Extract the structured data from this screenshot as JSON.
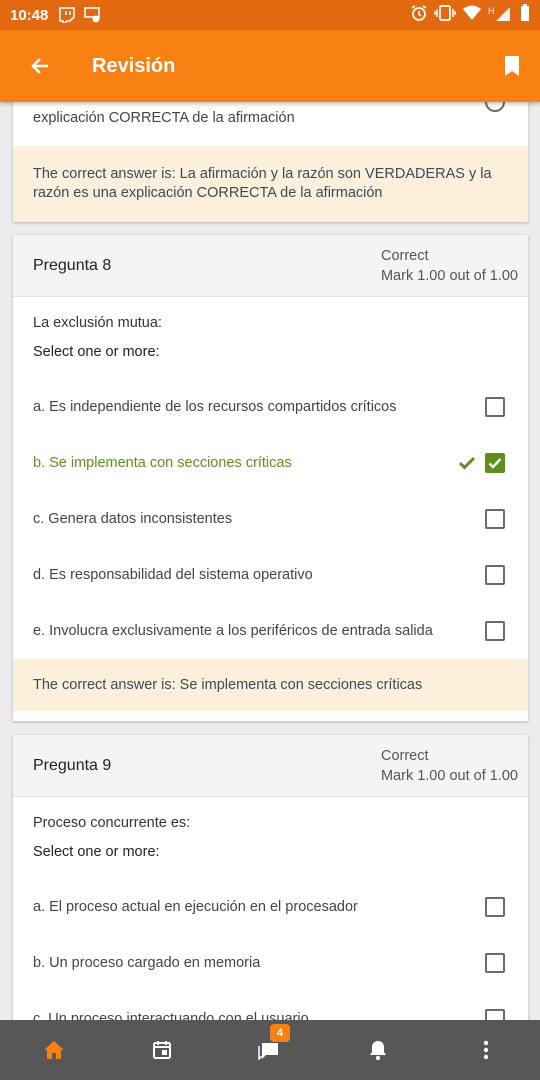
{
  "statusbar": {
    "time": "10:48"
  },
  "appbar": {
    "title": "Revisión"
  },
  "prev_card": {
    "option_text": "explicación CORRECTA de la afirmación",
    "feedback": "The correct answer is: La afirmación y la razón son VERDADERAS y la razón es una explicación CORRECTA de la afirmación"
  },
  "q8": {
    "title": "Pregunta 8",
    "status": "Correct",
    "mark": "Mark 1.00 out of 1.00",
    "question": "La exclusión mutua:",
    "instruction": "Select one or more:",
    "options": [
      {
        "label": "a. Es independiente de los recursos compartidos críticos",
        "checked": false
      },
      {
        "label": "b. Se implementa con secciones críticas",
        "checked": true
      },
      {
        "label": "c. Genera datos inconsistentes",
        "checked": false
      },
      {
        "label": "d. Es responsabilidad del sistema operativo",
        "checked": false
      },
      {
        "label": "e. Involucra exclusivamente a los periféricos de entrada salida",
        "checked": false
      }
    ],
    "feedback": "The correct answer is: Se implementa con secciones críticas"
  },
  "q9": {
    "title": "Pregunta 9",
    "status": "Correct",
    "mark": "Mark 1.00 out of 1.00",
    "question": "Proceso concurrente es:",
    "instruction": "Select one or more:",
    "options": [
      {
        "label": "a. El proceso actual en ejecución en el procesador",
        "checked": false
      },
      {
        "label": "b. Un proceso cargado en memoria",
        "checked": false
      },
      {
        "label": "c. Un proceso interactuando con el usuario",
        "checked": false
      }
    ]
  },
  "bottomnav": {
    "messages_badge": "4"
  },
  "colors": {
    "brand": "#f98012",
    "statusbar": "#e2690f",
    "correct": "#5e8f1e",
    "feedback_bg": "#fcefdc",
    "nav_bg": "#575757"
  }
}
